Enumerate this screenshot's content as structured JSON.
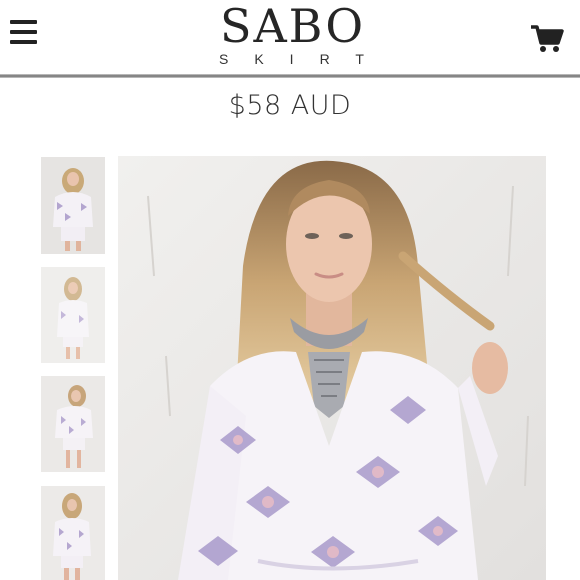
{
  "header": {
    "logo_main": "SABO",
    "logo_sub": "SKIRT",
    "menu_icon": "hamburger-menu-icon",
    "cart_icon": "shopping-cart-icon"
  },
  "product": {
    "price": "$58 AUD"
  },
  "gallery": {
    "thumbnail_count": 4,
    "selected_index": 0
  },
  "colors": {
    "text": "#333333",
    "print_lilac": "#a99ac6",
    "print_pink": "#e3b7c2",
    "background_wall": "#ebe9e6"
  }
}
